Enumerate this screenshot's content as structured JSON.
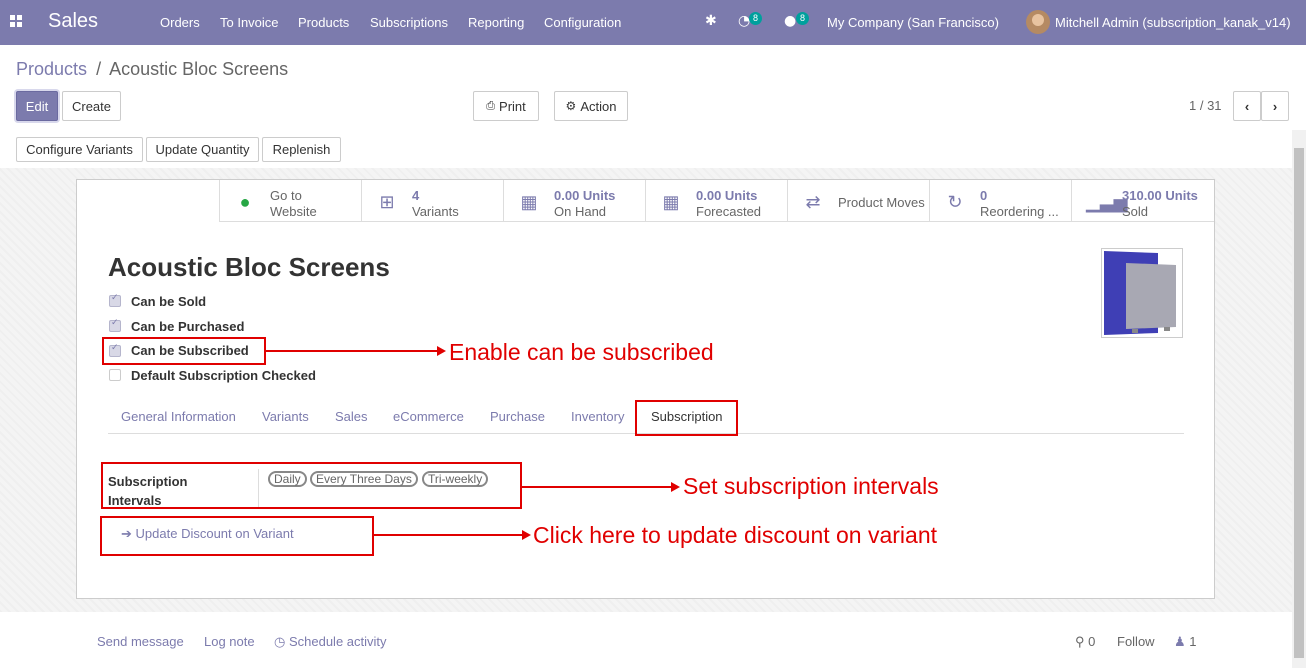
{
  "topbar": {
    "app_name": "Sales",
    "menu": [
      "Orders",
      "To Invoice",
      "Products",
      "Subscriptions",
      "Reporting",
      "Configuration"
    ],
    "activity_count": "8",
    "messages_count": "8",
    "company": "My Company (San Francisco)",
    "user": "Mitchell Admin (subscription_kanak_v14)"
  },
  "breadcrumb": {
    "parent": "Products",
    "separator": "/",
    "current": "Acoustic Bloc Screens"
  },
  "buttons": {
    "edit": "Edit",
    "create": "Create",
    "print": "Print",
    "action": "Action",
    "configure_variants": "Configure Variants",
    "update_quantity": "Update Quantity",
    "replenish": "Replenish"
  },
  "pager": {
    "value": "1 / 31"
  },
  "stats": [
    {
      "line1": "Go to",
      "line2": "Website",
      "icon": "globe-icon"
    },
    {
      "line1": "4",
      "line2": "Variants",
      "icon": "sitemap-icon"
    },
    {
      "line1": "0.00 Units",
      "line2": "On Hand",
      "icon": "cubes-icon"
    },
    {
      "line1": "0.00 Units",
      "line2": "Forecasted",
      "icon": "cubes-icon"
    },
    {
      "line1": "Product Moves",
      "line2": "",
      "icon": "exchange-icon"
    },
    {
      "line1": "0",
      "line2": "Reordering ...",
      "icon": "refresh-icon"
    },
    {
      "line1": "310.00 Units",
      "line2": "Sold",
      "icon": "signal-icon"
    }
  ],
  "product": {
    "name": "Acoustic Bloc Screens",
    "checkboxes": [
      {
        "label": "Can be Sold",
        "checked": true
      },
      {
        "label": "Can be Purchased",
        "checked": true
      },
      {
        "label": "Can be Subscribed",
        "checked": true
      },
      {
        "label": "Default Subscription Checked",
        "checked": false
      }
    ]
  },
  "tabs": [
    "General Information",
    "Variants",
    "Sales",
    "eCommerce",
    "Purchase",
    "Inventory",
    "Subscription"
  ],
  "subscription": {
    "field_label_1": "Subscription",
    "field_label_2": "Intervals",
    "intervals": [
      "Daily",
      "Every Three Days",
      "Tri-weekly"
    ],
    "update_discount": "Update Discount on Variant"
  },
  "annotations": {
    "enable": "Enable can be subscribed",
    "intervals": "Set subscription intervals",
    "discount": "Click here to update discount on variant"
  },
  "chatter": {
    "send_message": "Send message",
    "log_note": "Log note",
    "schedule_activity": "Schedule activity",
    "attachments": "0",
    "follow": "Follow",
    "followers": "1"
  },
  "colors": {
    "brand": "#7c7bad",
    "annotation": "#e00000"
  }
}
